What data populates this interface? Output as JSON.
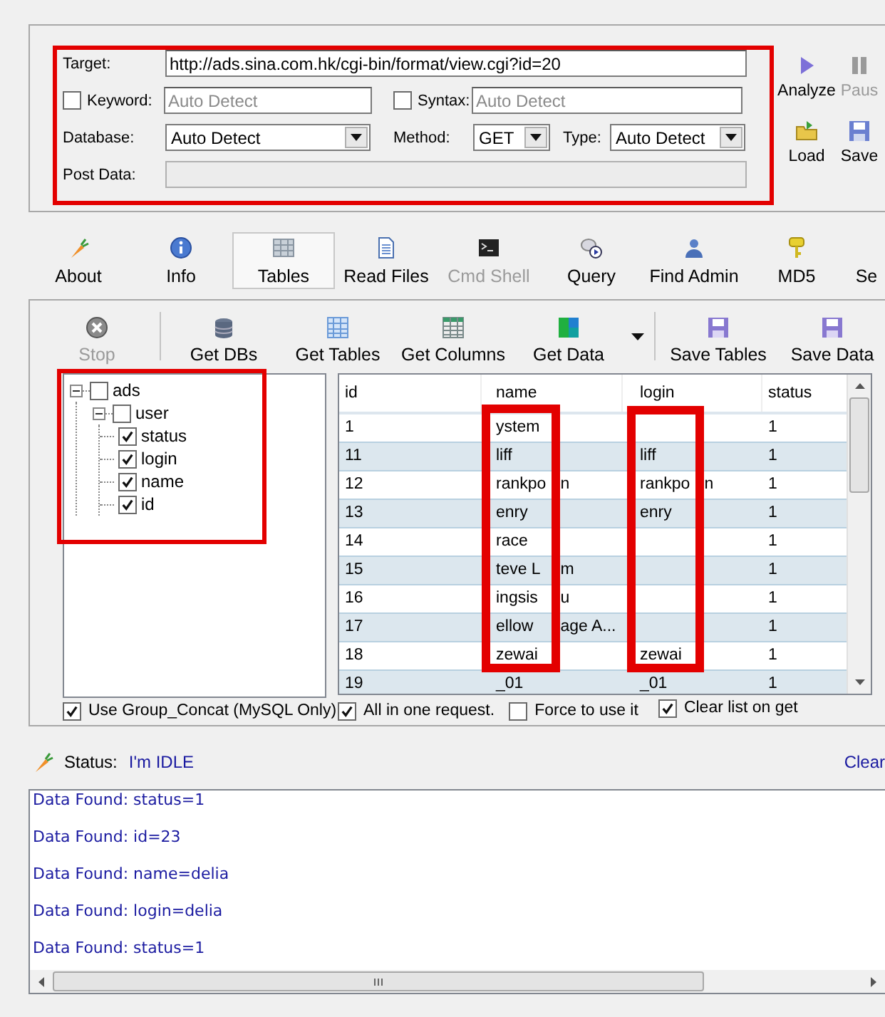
{
  "form": {
    "target": {
      "label": "Target:",
      "value": "http://ads.sina.com.hk/cgi-bin/format/view.cgi?id=20"
    },
    "keyword": {
      "label": "Keyword:",
      "checked": false,
      "placeholder": "Auto Detect"
    },
    "syntax": {
      "label": "Syntax:",
      "checked": false,
      "placeholder": "Auto Detect"
    },
    "database": {
      "label": "Database:",
      "value": "Auto Detect"
    },
    "method": {
      "label": "Method:",
      "value": "GET"
    },
    "type": {
      "label": "Type:",
      "value": "Auto Detect"
    },
    "post_data": {
      "label": "Post Data:",
      "disabled": true
    }
  },
  "actions": [
    {
      "label": "Analyze",
      "disabled": false
    },
    {
      "label": "Paus",
      "disabled": true
    },
    {
      "label": "Load",
      "disabled": false
    },
    {
      "label": "Save",
      "disabled": false
    }
  ],
  "tabs": [
    {
      "label": "About",
      "selected": false,
      "disabled": false
    },
    {
      "label": "Info",
      "selected": false,
      "disabled": false
    },
    {
      "label": "Tables",
      "selected": true,
      "disabled": false
    },
    {
      "label": "Read Files",
      "selected": false,
      "disabled": false
    },
    {
      "label": "Cmd Shell",
      "selected": false,
      "disabled": true
    },
    {
      "label": "Query",
      "selected": false,
      "disabled": false
    },
    {
      "label": "Find Admin",
      "selected": false,
      "disabled": false
    },
    {
      "label": "MD5",
      "selected": false,
      "disabled": false
    },
    {
      "label": "Se",
      "selected": false,
      "disabled": false
    }
  ],
  "toolbar": [
    {
      "kind": "button",
      "label": "Stop",
      "disabled": true
    },
    {
      "kind": "separator"
    },
    {
      "kind": "button",
      "label": "Get DBs",
      "disabled": false
    },
    {
      "kind": "button",
      "label": "Get Tables",
      "disabled": false
    },
    {
      "kind": "button",
      "label": "Get Columns",
      "disabled": false
    },
    {
      "kind": "button",
      "label": "Get Data",
      "disabled": false
    },
    {
      "kind": "dropdown"
    },
    {
      "kind": "separator"
    },
    {
      "kind": "button",
      "label": "Save Tables",
      "disabled": false
    },
    {
      "kind": "button",
      "label": "Save Data",
      "disabled": false
    }
  ],
  "tree": [
    {
      "label": "ads",
      "checked": false,
      "expanded": true,
      "children": [
        {
          "label": "user",
          "checked": false,
          "expanded": true,
          "children": [
            {
              "label": "status",
              "checked": true
            },
            {
              "label": "login",
              "checked": true
            },
            {
              "label": "name",
              "checked": true
            },
            {
              "label": "id",
              "checked": true
            }
          ]
        }
      ]
    }
  ],
  "table": {
    "columns": [
      "id",
      "name",
      "login",
      "status"
    ],
    "rows": [
      {
        "id": "1",
        "name": [
          "ystem"
        ],
        "status": "1"
      },
      {
        "id": "11",
        "name": [
          "liff"
        ],
        "login": [
          "liff"
        ],
        "status": "1"
      },
      {
        "id": "12",
        "name": [
          "rankpo",
          "n"
        ],
        "login": [
          "rankpo",
          "n"
        ],
        "status": "1"
      },
      {
        "id": "13",
        "name": [
          "enry"
        ],
        "login": [
          "enry"
        ],
        "status": "1"
      },
      {
        "id": "14",
        "name": [
          "race"
        ],
        "status": "1"
      },
      {
        "id": "15",
        "name": [
          "teve L",
          "m"
        ],
        "status": "1"
      },
      {
        "id": "16",
        "name": [
          "ingsis",
          "u"
        ],
        "status": "1"
      },
      {
        "id": "17",
        "name": [
          "ellow",
          "age A..."
        ],
        "status": "1"
      },
      {
        "id": "18",
        "name": [
          "zewai"
        ],
        "login": [
          "zewai"
        ],
        "status": "1"
      },
      {
        "id": "19",
        "name": [
          "_01"
        ],
        "login": [
          "_01"
        ],
        "status": "1"
      }
    ]
  },
  "tree_options": [
    {
      "label": "Use Group_Concat (MySQL Only)",
      "checked": true
    }
  ],
  "table_options": [
    {
      "label": "All in one request.",
      "checked": true
    },
    {
      "label": "Force to use it",
      "checked": false
    },
    {
      "label": "Clear list on get",
      "checked": true
    }
  ],
  "status": {
    "label": "Status:",
    "value": "I'm IDLE",
    "link": "Clear"
  },
  "log": [
    "Data Found: status=1",
    "Data Found: id=23",
    "Data Found: name=delia",
    "Data Found: login=delia",
    "Data Found: status=1"
  ]
}
